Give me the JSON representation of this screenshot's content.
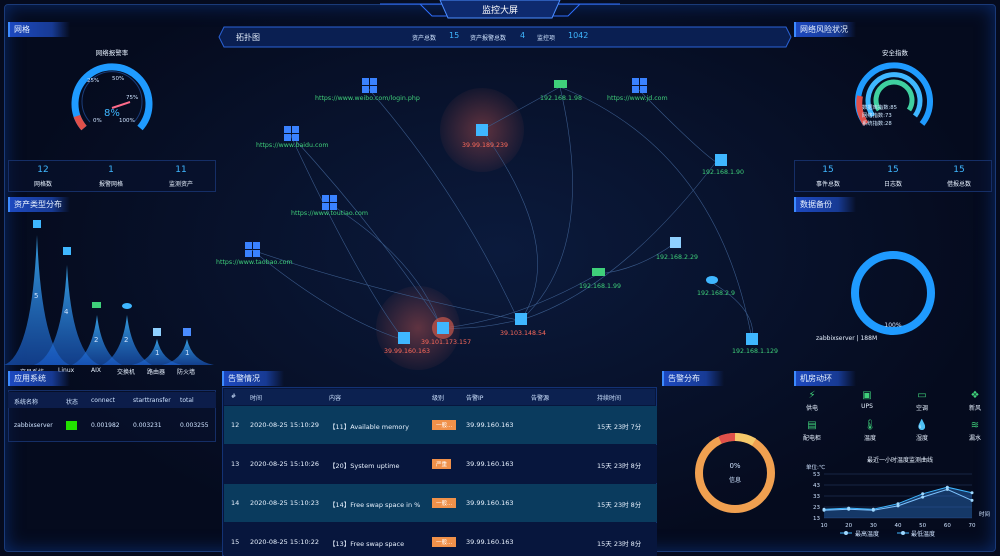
{
  "header": {
    "title": "监控大屏"
  },
  "network": {
    "title": "网格",
    "gauge_title": "网络报警率",
    "gauge_value": "8%",
    "gauge_ticks": [
      "25%",
      "50%",
      "75%",
      "0%",
      "100%"
    ],
    "gauge_fraction": 0.08,
    "stats": [
      {
        "value": "12",
        "label": "网格数"
      },
      {
        "value": "1",
        "label": "报警网格"
      },
      {
        "value": "11",
        "label": "监测资产"
      }
    ]
  },
  "asset_types": {
    "title": "资产类型分布",
    "peaks": [
      {
        "value": "5",
        "label": "交易系统"
      },
      {
        "value": "4",
        "label": "Linux"
      },
      {
        "value": "2",
        "label": "AIX"
      },
      {
        "value": "2",
        "label": "交换机"
      },
      {
        "value": "1",
        "label": "路由器"
      },
      {
        "value": "1",
        "label": "防火墙"
      }
    ]
  },
  "topology": {
    "title": "拓扑图",
    "summary": [
      {
        "label": "资产总数",
        "value": "15"
      },
      {
        "label": "资产报警总数",
        "value": "4"
      },
      {
        "label": "监控项",
        "value": "1042"
      }
    ],
    "nodes": [
      {
        "label": "https://www.weibo.com/login.php",
        "status": "ok"
      },
      {
        "label": "192.168.1.98",
        "status": "ok"
      },
      {
        "label": "https://www.jd.com",
        "status": "ok"
      },
      {
        "label": "39.99.189.239",
        "status": "alert"
      },
      {
        "label": "https://www.baidu.com",
        "status": "ok"
      },
      {
        "label": "192.168.1.90",
        "status": "ok"
      },
      {
        "label": "https://www.toutiao.com",
        "status": "ok"
      },
      {
        "label": "https://www.taobao.com",
        "status": "ok"
      },
      {
        "label": "192.168.2.29",
        "status": "ok"
      },
      {
        "label": "192.168.1.99",
        "status": "ok"
      },
      {
        "label": "192.168.2.9",
        "status": "ok"
      },
      {
        "label": "39.103.148.54",
        "status": "alert"
      },
      {
        "label": "39.101.173.157",
        "status": "alert"
      },
      {
        "label": "39.99.160.163",
        "status": "alert"
      },
      {
        "label": "192.168.1.129",
        "status": "ok"
      }
    ]
  },
  "risk": {
    "title": "网络风险状况",
    "gauge_title": "安全指数",
    "lines": [
      "数据库指数:85",
      "网络指数:73",
      "系统指数:28"
    ],
    "stats": [
      {
        "value": "15",
        "label": "事件总数"
      },
      {
        "value": "15",
        "label": "日志数"
      },
      {
        "value": "15",
        "label": "借报总数"
      }
    ]
  },
  "backup": {
    "title": "数据备份",
    "ring_label": "100%",
    "server": "zabbixserver | 188M",
    "fraction": 1.0
  },
  "app_system": {
    "title": "应用系统",
    "headers": [
      "系统名称",
      "状态",
      "connect",
      "starttransfer",
      "total"
    ],
    "rows": [
      {
        "name": "zabbixserver",
        "status_color": "#22e000",
        "connect": "0.001982",
        "starttransfer": "0.003231",
        "total": "0.003255"
      }
    ]
  },
  "alerts": {
    "title": "告警情况",
    "headers": [
      "#",
      "时间",
      "内容",
      "级别",
      "告警IP",
      "告警源",
      "持续时间"
    ],
    "rows": [
      {
        "id": "12",
        "time": "2020-08-25 15:10:29",
        "content": "【11】Available memory",
        "level": "一般...",
        "ip": "39.99.160.163",
        "source": "",
        "duration": "15天 23时 7分"
      },
      {
        "id": "13",
        "time": "2020-08-25 15:10:26",
        "content": "【20】System uptime",
        "level": "严重",
        "ip": "39.99.160.163",
        "source": "",
        "duration": "15天 23时 8分"
      },
      {
        "id": "14",
        "time": "2020-08-25 15:10:23",
        "content": "【14】Free swap space in %",
        "level": "一般...",
        "ip": "39.99.160.163",
        "source": "",
        "duration": "15天 23时 8分"
      },
      {
        "id": "15",
        "time": "2020-08-25 15:10:22",
        "content": "【13】Free swap space",
        "level": "一般...",
        "ip": "39.99.160.163",
        "source": "",
        "duration": "15天 23时 8分"
      }
    ]
  },
  "alert_dist": {
    "title": "告警分布",
    "center_value": "0%",
    "center_label": "信息"
  },
  "room": {
    "title": "机房动环",
    "items": [
      {
        "icon": "lightning-icon",
        "label": "供电"
      },
      {
        "icon": "ups-icon",
        "label": "UPS"
      },
      {
        "icon": "aircon-icon",
        "label": "空调"
      },
      {
        "icon": "fresh-air-icon",
        "label": "新风"
      },
      {
        "icon": "cabinet-icon",
        "label": "配电柜"
      },
      {
        "icon": "thermometer-icon",
        "label": "温度"
      },
      {
        "icon": "humidity-icon",
        "label": "湿度"
      },
      {
        "icon": "water-leak-icon",
        "label": "漏水"
      }
    ],
    "chart_title": "最近一小时温度监测曲线",
    "unit": "单位:℃",
    "legend": [
      "最高温度",
      "最低温度"
    ]
  },
  "chart_data": {
    "type": "line",
    "title": "最近一小时温度监测曲线",
    "ylabel": "单位:℃",
    "xlabel": "时间",
    "x": [
      10,
      20,
      30,
      40,
      50,
      60,
      70
    ],
    "y_ticks": [
      13,
      23,
      33,
      43,
      53
    ],
    "ylim": [
      13,
      53
    ],
    "series": [
      {
        "name": "最高温度",
        "values": [
          21,
          22,
          21,
          26,
          35,
          41,
          36
        ]
      },
      {
        "name": "最低温度",
        "values": [
          20,
          21,
          20,
          24,
          32,
          39,
          29
        ]
      }
    ]
  }
}
